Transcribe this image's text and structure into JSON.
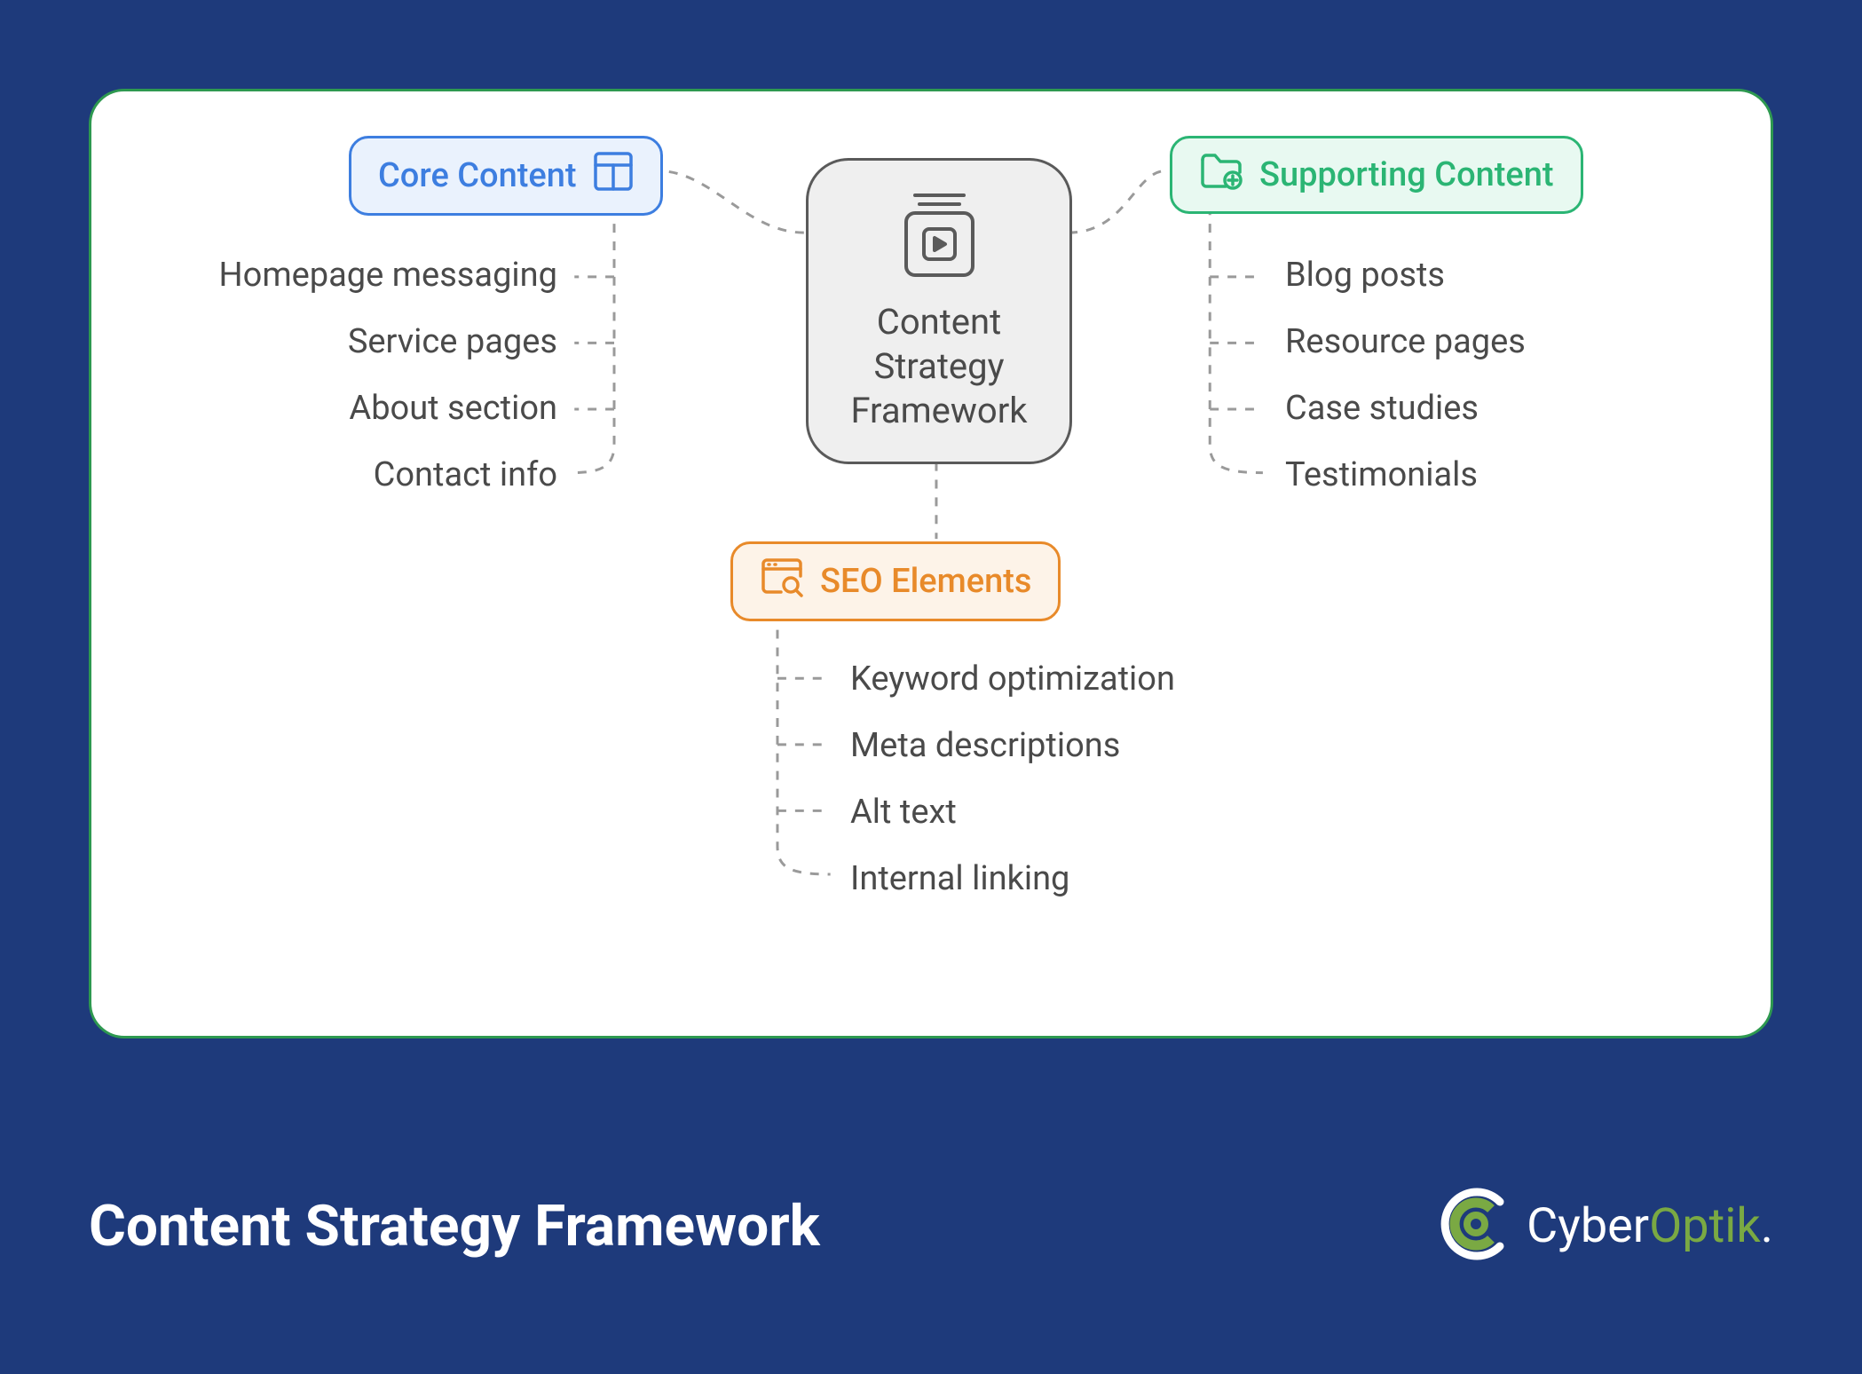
{
  "center": {
    "label": "Content\nStrategy\nFramework"
  },
  "branches": {
    "core": {
      "label": "Core Content",
      "items": [
        "Homepage messaging",
        "Service pages",
        "About section",
        "Contact info"
      ]
    },
    "supporting": {
      "label": "Supporting Content",
      "items": [
        "Blog posts",
        "Resource pages",
        "Case studies",
        "Testimonials"
      ]
    },
    "seo": {
      "label": "SEO Elements",
      "items": [
        "Keyword optimization",
        "Meta descriptions",
        "Alt text",
        "Internal linking"
      ]
    }
  },
  "footer": {
    "title": "Content Strategy Framework",
    "brand_part1": "Cyber",
    "brand_part2": "Optik"
  },
  "colors": {
    "background": "#1e3a7b",
    "canvas_border": "#2e9950",
    "core": "#3d7ee0",
    "supporting": "#2bb574",
    "seo": "#e88a2a",
    "text": "#4a4a4a"
  }
}
